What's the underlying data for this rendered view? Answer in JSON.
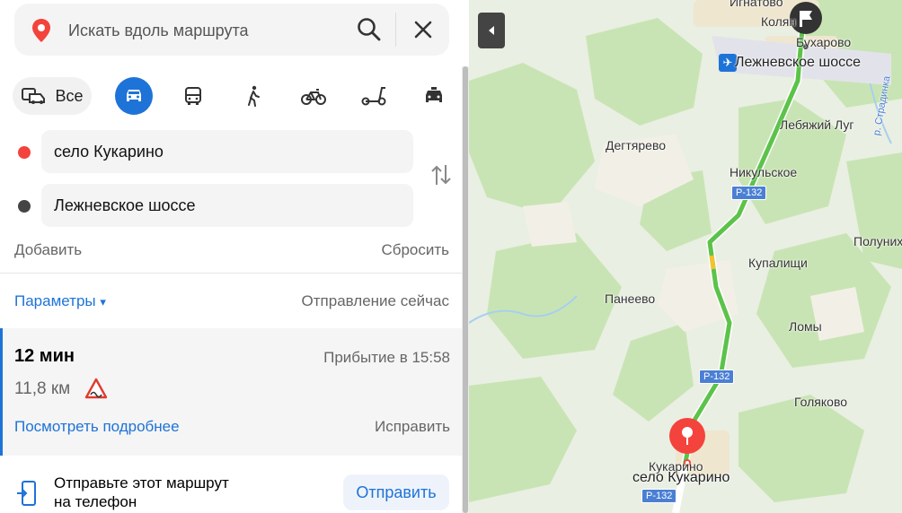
{
  "search": {
    "placeholder": "Искать вдоль маршрута"
  },
  "modes": {
    "all_label": "Все"
  },
  "route": {
    "from": "село Кукарино",
    "to": "Лежневское шоссе",
    "add_label": "Добавить",
    "reset_label": "Сбросить",
    "params_label": "Параметры",
    "params_caret": "▾",
    "departure_label": "Отправление сейчас"
  },
  "result": {
    "duration": "12 мин",
    "arrival": "Прибытие в 15:58",
    "distance": "11,8 км",
    "details_label": "Посмотреть подробнее",
    "fix_label": "Исправить"
  },
  "send": {
    "text_line1": "Отправьте этот маршрут",
    "text_line2": "на телефон",
    "button_label": "Отправить"
  },
  "map": {
    "labels": {
      "ignatovo": "Игнатово",
      "kolyan": "Колян",
      "bukharovo": "Бухарово",
      "lezhnevskoe": "Лежневское шоссе",
      "lebyazhiy": "Лебяжий Луг",
      "degtyarevo": "Дегтярево",
      "nikulskoe": "Никульское",
      "polunikh": "Полуних",
      "kupalishchi": "Купалищи",
      "paneevo": "Панеево",
      "lomy": "Ломы",
      "golyakovo": "Голяково",
      "kukarino_small": "Кукарино",
      "kukarino_big": "село Кукарино",
      "stradinka": "р. Страдинка"
    },
    "road": "Р-132",
    "colors": {
      "route": "#5cc34a",
      "pin": "#f4433c",
      "accent": "#1e73d8"
    }
  }
}
